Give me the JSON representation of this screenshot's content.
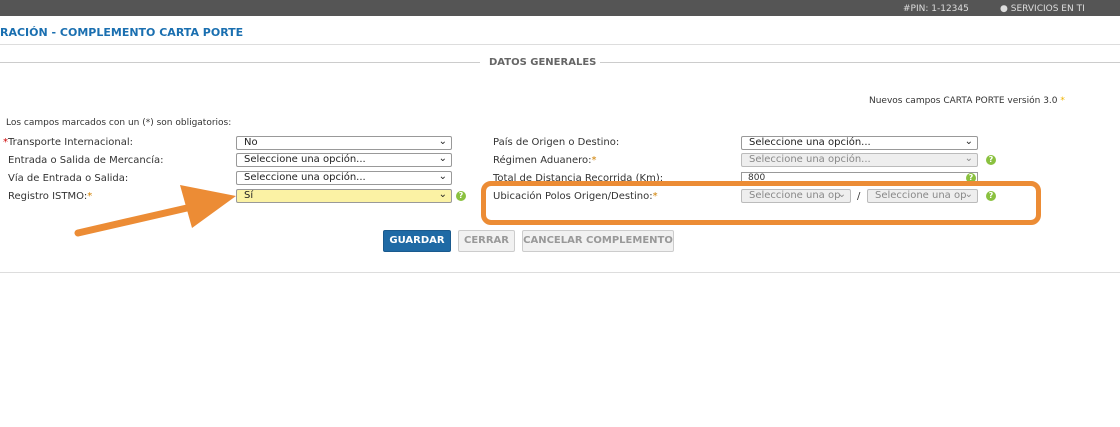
{
  "topbar": {
    "pin": "#PIN: 1-12345",
    "services": "SERVICIOS EN TI"
  },
  "page": {
    "title": "RACIÓN - COMPLEMENTO CARTA PORTE",
    "section": "DATOS GENERALES"
  },
  "notes": {
    "version": "Nuevos campos CARTA PORTE versión 3.0",
    "required": "Los campos marcados con un (*) son obligatorios:"
  },
  "left_fields": [
    {
      "label": "Transporte Internacional:",
      "value": "No"
    },
    {
      "label": "Entrada o Salida de Mercancía:",
      "value": "Seleccione una opción..."
    },
    {
      "label": "Vía de Entrada o Salida:",
      "value": "Seleccione una opción..."
    },
    {
      "label": "Registro ISTMO:",
      "value": "Sí"
    }
  ],
  "right_fields": [
    {
      "label": "País de Origen o Destino:",
      "value": "Seleccione una opción..."
    },
    {
      "label": "Régimen Aduanero:",
      "value": "Seleccione una opción..."
    },
    {
      "label": "Total de Distancia Recorrida (Km):",
      "value": "800"
    },
    {
      "label": "Ubicación Polos Origen/Destino:",
      "value_origin": "Seleccione una op",
      "value_dest": "Seleccione una op",
      "separator": "/"
    }
  ],
  "buttons": {
    "save": "GUARDAR",
    "close": "CERRAR",
    "cancel": "CANCELAR COMPLEMENTO"
  },
  "icons": {
    "help": "help-icon",
    "chevron": "chevron-down-icon",
    "user": "user-icon",
    "annotation": "arrow-annotation"
  },
  "colors": {
    "accent": "#1f6aa5",
    "highlight": "#ec8c35",
    "required": "#f0b400",
    "help": "#8ac13f"
  }
}
